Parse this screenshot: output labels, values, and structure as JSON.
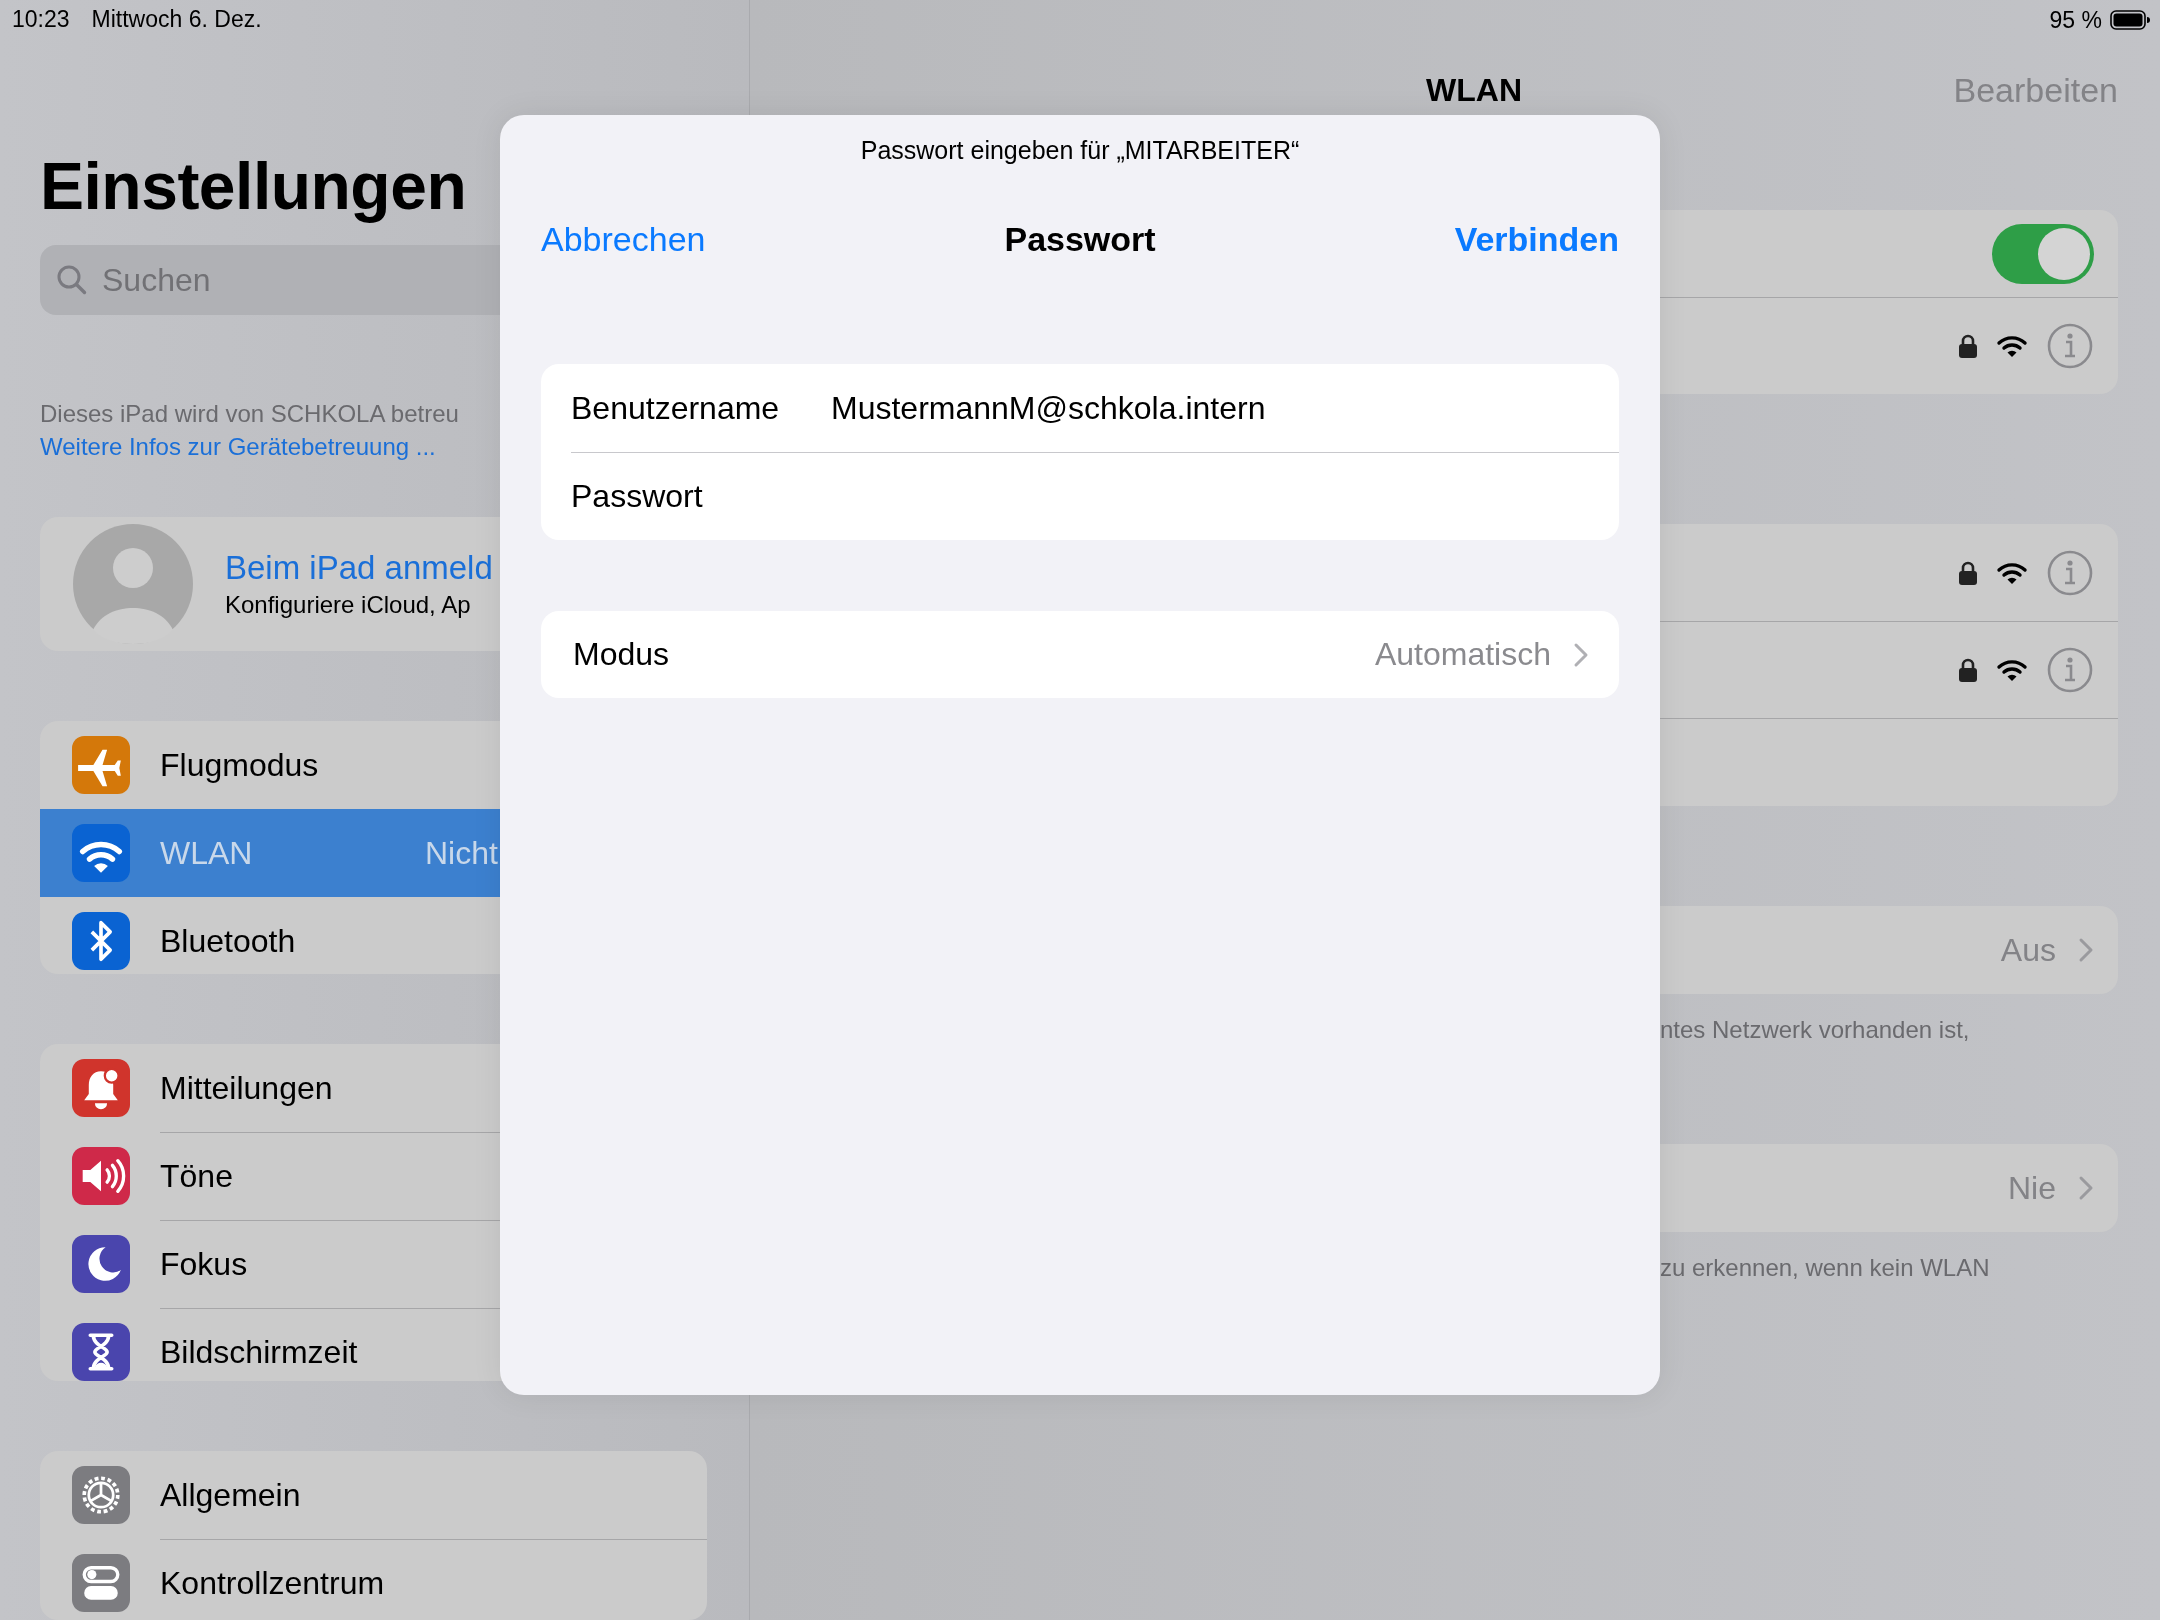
{
  "status_bar": {
    "time": "10:23",
    "date": "Mittwoch 6. Dez.",
    "battery": "95 %"
  },
  "sidebar": {
    "title": "Einstellungen",
    "search": {
      "placeholder": "Suchen"
    },
    "managed_note": "Dieses iPad wird von SCHKOLA betreu",
    "managed_link": "Weitere Infos zur Gerätebetreuung ...",
    "account": {
      "title": "Beim iPad anmeld",
      "subtitle": "Konfiguriere iCloud, Ap"
    },
    "groups": [
      {
        "items": [
          {
            "label": "Flugmodus",
            "color": "#d4780a",
            "selected": false
          },
          {
            "label": "WLAN",
            "value": "Nicht",
            "color": "#0a63d2",
            "selected": true
          },
          {
            "label": "Bluetooth",
            "color": "#0a63d2",
            "selected": false
          }
        ]
      },
      {
        "items": [
          {
            "label": "Mitteilungen",
            "color": "#d0342c",
            "selected": false
          },
          {
            "label": "Töne",
            "color": "#cf2949",
            "selected": false
          },
          {
            "label": "Fokus",
            "color": "#4a45ad",
            "selected": false
          },
          {
            "label": "Bildschirmzeit",
            "color": "#4a45ad",
            "selected": false
          }
        ]
      },
      {
        "items": [
          {
            "label": "Allgemein",
            "color": "#7c7c80",
            "selected": false
          },
          {
            "label": "Kontrollzentrum",
            "color": "#7c7c80",
            "selected": false
          }
        ]
      }
    ]
  },
  "wlan": {
    "title": "WLAN",
    "edit": "Bearbeiten",
    "wifi_switch": {
      "on": true
    },
    "settings": [
      {
        "value": "Aus",
        "note": "ntes Netzwerk vorhanden ist,"
      },
      {
        "value": "Nie",
        "note": "zu erkennen, wenn kein WLAN"
      }
    ]
  },
  "dialog": {
    "prompt": "Passwort eingeben für „MITARBEITER“",
    "cancel": "Abbrechen",
    "title": "Passwort",
    "confirm": "Verbinden",
    "fields": [
      {
        "label": "Benutzername",
        "value": "MustermannM@schkola.intern"
      },
      {
        "label": "Passwort"
      }
    ],
    "mode": {
      "label": "Modus",
      "value": "Automatisch"
    }
  }
}
